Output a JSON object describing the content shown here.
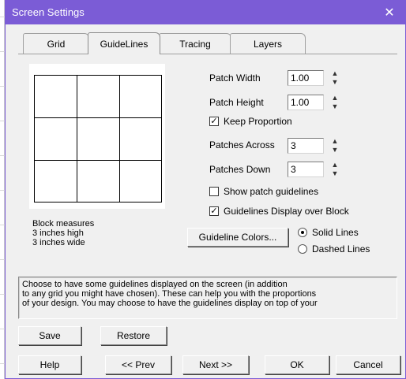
{
  "window": {
    "title": "Screen Settings",
    "close_glyph": "✕"
  },
  "tabs": [
    "Grid",
    "GuideLines",
    "Tracing",
    "Layers"
  ],
  "active_tab": "GuideLines",
  "fields": {
    "patch_width": {
      "label": "Patch Width",
      "value": "1.00"
    },
    "patch_height": {
      "label": "Patch Height",
      "value": "1.00"
    },
    "patches_across": {
      "label": "Patches Across",
      "value": "3"
    },
    "patches_down": {
      "label": "Patches Down",
      "value": "3"
    }
  },
  "checkboxes": {
    "keep_proportion": {
      "label": "Keep Proportion",
      "checked": true
    },
    "show_patch_guidelines": {
      "label": "Show patch guidelines",
      "checked": false
    },
    "display_over_block": {
      "label": "Guidelines Display over Block",
      "checked": true
    }
  },
  "block_measures": {
    "line1": "Block measures",
    "line2": "3 inches high",
    "line3": "3 inches wide"
  },
  "guideline_colors_button": "Guideline Colors...",
  "line_style": {
    "solid": "Solid Lines",
    "dashed": "Dashed Lines",
    "selected": "solid"
  },
  "help_text": [
    "Choose to have some guidelines displayed on the screen (in addition",
    "to any grid you might have chosen). These can help you with the proportions",
    "of your design. You may choose to have the guidelines display on top of your"
  ],
  "buttons": {
    "save": "Save",
    "restore": "Restore",
    "help": "Help",
    "prev": "<< Prev",
    "next": "Next >>",
    "ok": "OK",
    "cancel": "Cancel"
  },
  "colors": {
    "titlebar": "#7b5cd6",
    "dialog_bg": "#f0f0f0"
  },
  "spinner_icon": {
    "up": "▲",
    "down": "▼"
  },
  "check_glyph": "✓"
}
